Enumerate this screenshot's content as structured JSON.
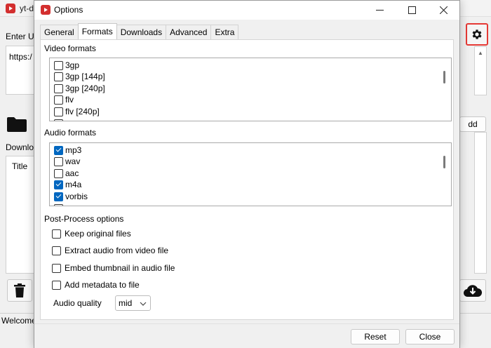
{
  "main_window": {
    "title": "yt-d",
    "enter_url_label": "Enter Ul",
    "url_text": "https:/",
    "add_button": "dd",
    "downloads_label": "Downlo",
    "list_header_title": "Title",
    "status_text": "Welcome"
  },
  "dialog": {
    "title": "Options",
    "tabs": [
      {
        "label": "General",
        "active": false
      },
      {
        "label": "Formats",
        "active": true
      },
      {
        "label": "Downloads",
        "active": false
      },
      {
        "label": "Advanced",
        "active": false
      },
      {
        "label": "Extra",
        "active": false
      }
    ],
    "video_formats": {
      "title": "Video formats",
      "items": [
        {
          "label": "3gp",
          "checked": false
        },
        {
          "label": "3gp [144p]",
          "checked": false
        },
        {
          "label": "3gp [240p]",
          "checked": false
        },
        {
          "label": "flv",
          "checked": false
        },
        {
          "label": "flv [240p]",
          "checked": false
        }
      ]
    },
    "audio_formats": {
      "title": "Audio formats",
      "items": [
        {
          "label": "mp3",
          "checked": true
        },
        {
          "label": "wav",
          "checked": false
        },
        {
          "label": "aac",
          "checked": false
        },
        {
          "label": "m4a",
          "checked": true
        },
        {
          "label": "vorbis",
          "checked": true
        }
      ]
    },
    "post_process": {
      "title": "Post-Process options",
      "items": [
        {
          "label": "Keep original files",
          "checked": false
        },
        {
          "label": "Extract audio from video file",
          "checked": false
        },
        {
          "label": "Embed thumbnail in audio file",
          "checked": false
        },
        {
          "label": "Add metadata to file",
          "checked": false
        }
      ]
    },
    "audio_quality": {
      "label": "Audio quality",
      "value": "mid"
    },
    "buttons": {
      "reset": "Reset",
      "close": "Close"
    }
  },
  "colors": {
    "accent": "#0067c0",
    "highlight_border": "#e53935",
    "app_icon": "#d32f2f"
  }
}
